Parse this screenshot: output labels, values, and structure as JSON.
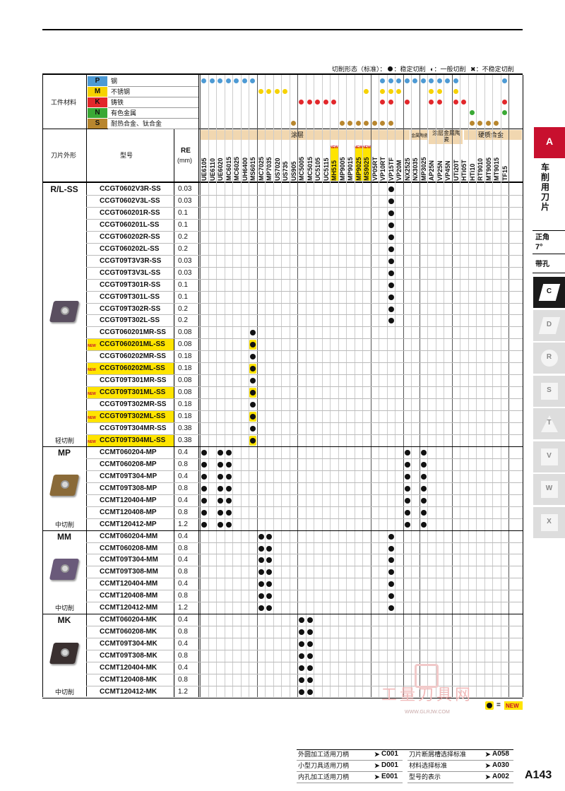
{
  "legend": {
    "title": "切削形态（标准）：",
    "stable": "：稳定切削",
    "general": "：一般切削",
    "unstable": "：不稳定切削"
  },
  "header": {
    "workpiece_label": "工件材料",
    "insert_shape_label": "刀片外形",
    "model_label": "型号",
    "re_label": "RE",
    "re_unit": "(mm)",
    "materials": [
      {
        "code": "P",
        "name": "钢",
        "color": "#4d9ad4"
      },
      {
        "code": "M",
        "name": "不锈钢",
        "color": "#f6d200"
      },
      {
        "code": "K",
        "name": "铸铁",
        "color": "#e2272b"
      },
      {
        "code": "N",
        "name": "有色金属",
        "color": "#3aa935"
      },
      {
        "code": "S",
        "name": "耐热合金、钛合金",
        "color": "#b8862e"
      }
    ],
    "groups": {
      "coated": "涂层",
      "cermet": "金属陶瓷",
      "coated_cermet": "涂层金属陶瓷",
      "carbide": "硬质合金"
    },
    "new_tag": "NEW",
    "newnew_tag": "NEWNEW"
  },
  "grades": [
    "UE6105",
    "UE6110",
    "UE6020",
    "MC6015",
    "MC6025",
    "UH6400",
    "MS6015",
    "MC7025",
    "MP7035",
    "US7020",
    "US735",
    "US905",
    "MC5005",
    "MC5015",
    "UC5105",
    "UC5115",
    "MH515",
    "MP9005",
    "MP9015",
    "MP9025",
    "MS9025",
    "VP05RT",
    "VP10RT",
    "VP15TF",
    "VP20M",
    "NX2525",
    "NX3035",
    "MP3025",
    "AP25N",
    "VP25N",
    "VP45N",
    "UTi20T",
    "HTi05T",
    "HTi10",
    "RT9010",
    "MT9005",
    "MT9015",
    "TF15"
  ],
  "sections": [
    {
      "name": "R/L-SS",
      "sub": "轻切削",
      "rows": [
        {
          "model": "CCGT0602V3R-SS",
          "re": "0.03",
          "new": false
        },
        {
          "model": "CCGT0602V3L-SS",
          "re": "0.03",
          "new": false
        },
        {
          "model": "CCGT060201R-SS",
          "re": "0.1",
          "new": false
        },
        {
          "model": "CCGT060201L-SS",
          "re": "0.1",
          "new": false
        },
        {
          "model": "CCGT060202R-SS",
          "re": "0.2",
          "new": false
        },
        {
          "model": "CCGT060202L-SS",
          "re": "0.2",
          "new": false
        },
        {
          "model": "CCGT09T3V3R-SS",
          "re": "0.03",
          "new": false
        },
        {
          "model": "CCGT09T3V3L-SS",
          "re": "0.03",
          "new": false
        },
        {
          "model": "CCGT09T301R-SS",
          "re": "0.1",
          "new": false
        },
        {
          "model": "CCGT09T301L-SS",
          "re": "0.1",
          "new": false
        },
        {
          "model": "CCGT09T302R-SS",
          "re": "0.2",
          "new": false
        },
        {
          "model": "CCGT09T302L-SS",
          "re": "0.2",
          "new": false
        },
        {
          "model": "CCGT060201MR-SS",
          "re": "0.08",
          "new": false
        },
        {
          "model": "CCGT060201ML-SS",
          "re": "0.08",
          "new": true
        },
        {
          "model": "CCGT060202MR-SS",
          "re": "0.18",
          "new": false
        },
        {
          "model": "CCGT060202ML-SS",
          "re": "0.18",
          "new": true
        },
        {
          "model": "CCGT09T301MR-SS",
          "re": "0.08",
          "new": false
        },
        {
          "model": "CCGT09T301ML-SS",
          "re": "0.08",
          "new": true
        },
        {
          "model": "CCGT09T302MR-SS",
          "re": "0.18",
          "new": false
        },
        {
          "model": "CCGT09T302ML-SS",
          "re": "0.18",
          "new": true
        },
        {
          "model": "CCGT09T304MR-SS",
          "re": "0.38",
          "new": false
        },
        {
          "model": "CCGT09T304ML-SS",
          "re": "0.38",
          "new": true
        }
      ]
    },
    {
      "name": "MP",
      "sub": "中切削",
      "rows": [
        {
          "model": "CCMT060204-MP",
          "re": "0.4",
          "new": false
        },
        {
          "model": "CCMT060208-MP",
          "re": "0.8",
          "new": false
        },
        {
          "model": "CCMT09T304-MP",
          "re": "0.4",
          "new": false
        },
        {
          "model": "CCMT09T308-MP",
          "re": "0.8",
          "new": false
        },
        {
          "model": "CCMT120404-MP",
          "re": "0.4",
          "new": false
        },
        {
          "model": "CCMT120408-MP",
          "re": "0.8",
          "new": false
        },
        {
          "model": "CCMT120412-MP",
          "re": "1.2",
          "new": false
        }
      ]
    },
    {
      "name": "MM",
      "sub": "中切削",
      "rows": [
        {
          "model": "CCMT060204-MM",
          "re": "0.4",
          "new": false
        },
        {
          "model": "CCMT060208-MM",
          "re": "0.8",
          "new": false
        },
        {
          "model": "CCMT09T304-MM",
          "re": "0.4",
          "new": false
        },
        {
          "model": "CCMT09T308-MM",
          "re": "0.8",
          "new": false
        },
        {
          "model": "CCMT120404-MM",
          "re": "0.4",
          "new": false
        },
        {
          "model": "CCMT120408-MM",
          "re": "0.8",
          "new": false
        },
        {
          "model": "CCMT120412-MM",
          "re": "1.2",
          "new": false
        }
      ]
    },
    {
      "name": "MK",
      "sub": "中切削",
      "rows": [
        {
          "model": "CCMT060204-MK",
          "re": "0.4",
          "new": false
        },
        {
          "model": "CCMT060208-MK",
          "re": "0.8",
          "new": false
        },
        {
          "model": "CCMT09T304-MK",
          "re": "0.4",
          "new": false
        },
        {
          "model": "CCMT09T308-MK",
          "re": "0.8",
          "new": false
        },
        {
          "model": "CCMT120404-MK",
          "re": "0.4",
          "new": false
        },
        {
          "model": "CCMT120408-MK",
          "re": "0.8",
          "new": false
        },
        {
          "model": "CCMT120412-MK",
          "re": "1.2",
          "new": false
        }
      ]
    }
  ],
  "footer_legend": {
    "new": "NEW"
  },
  "side_tabs": {
    "A": "A",
    "section_title": "车削用刀片",
    "angle": "正角",
    "angle_deg": "7°",
    "hole": "带孔",
    "letters": [
      "C",
      "D",
      "R",
      "S",
      "T",
      "V",
      "W",
      "X"
    ]
  },
  "references": [
    {
      "label": "外圆加工适用刀柄",
      "page": "C001"
    },
    {
      "label": "小型刀具适用刀柄",
      "page": "D001"
    },
    {
      "label": "内孔加工适用刀柄",
      "page": "E001"
    },
    {
      "label": "刀片断屑槽选择标准",
      "page": "A058"
    },
    {
      "label": "材料选择标准",
      "page": "A030"
    },
    {
      "label": "型号的表示",
      "page": "A002"
    }
  ],
  "watermark": {
    "brand": "工量刀具网",
    "url": "WWW.GLRJW.COM"
  },
  "page_number": "A143"
}
